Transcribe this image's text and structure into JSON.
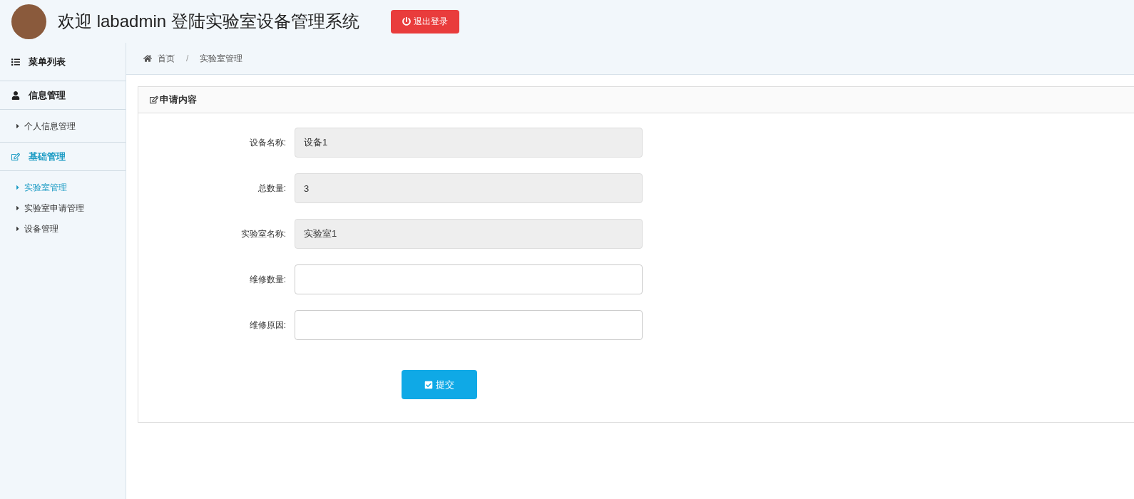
{
  "header": {
    "title": "欢迎 labadmin 登陆实验室设备管理系统",
    "logout_button": "退出登录"
  },
  "sidebar": {
    "title": "菜单列表",
    "groups": [
      {
        "label": "信息管理",
        "active": false,
        "items": [
          {
            "label": "个人信息管理",
            "selected": false
          }
        ]
      },
      {
        "label": "基础管理",
        "active": true,
        "items": [
          {
            "label": "实验室管理",
            "selected": true
          },
          {
            "label": "实验室申请管理",
            "selected": false
          },
          {
            "label": "设备管理",
            "selected": false
          }
        ]
      }
    ]
  },
  "breadcrumb": {
    "separator": "/",
    "items": [
      "首页",
      "实验室管理"
    ]
  },
  "form": {
    "title": "申请内容",
    "fields": [
      {
        "label": "设备名称:",
        "value": "设备1",
        "disabled": true
      },
      {
        "label": "总数量:",
        "value": "3",
        "disabled": true
      },
      {
        "label": "实验室名称:",
        "value": "实验室1",
        "disabled": true
      },
      {
        "label": "维修数量:",
        "disabled": false
      },
      {
        "label": "维修原因:",
        "disabled": false
      }
    ],
    "submit_button": "提交"
  }
}
